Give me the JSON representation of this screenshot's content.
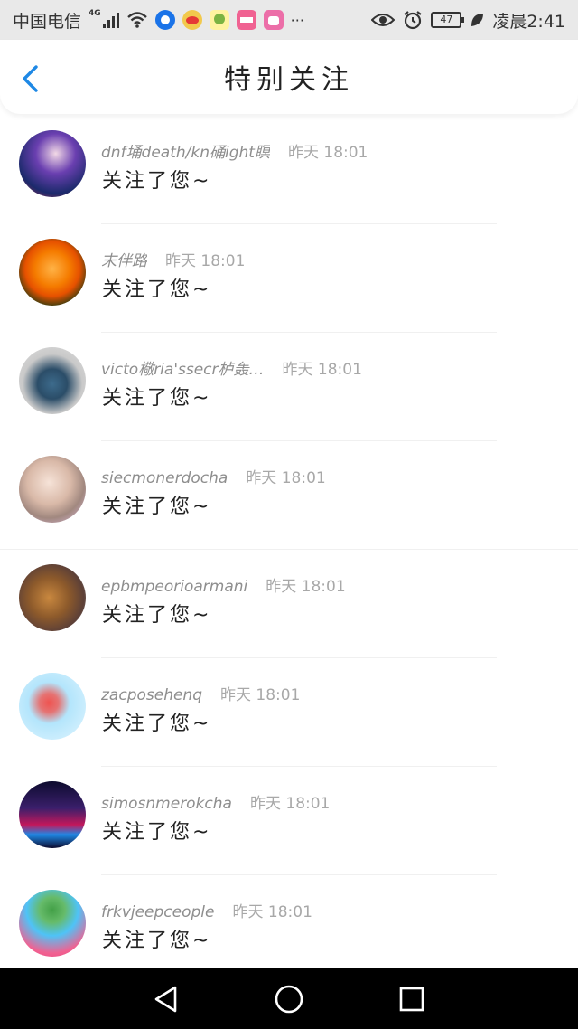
{
  "status_bar": {
    "carrier": "中国电信",
    "network": "4G",
    "battery": "47",
    "time": "凌晨2:41",
    "more": "···"
  },
  "header": {
    "title": "特别关注",
    "back_icon": "chevron-left-icon",
    "accent": "#1e88e5"
  },
  "list": [
    {
      "name": "dnf埇death/kn硧ight瞑",
      "time": "昨天 18:01",
      "message": "关注了您~"
    },
    {
      "name": "末伴路",
      "time": "昨天 18:01",
      "message": "关注了您~"
    },
    {
      "name": "victo㯳ria'ssecr栌轰…",
      "time": "昨天 18:01",
      "message": "关注了您~"
    },
    {
      "name": "siecmonerdocha",
      "time": "昨天 18:01",
      "message": "关注了您~"
    },
    {
      "name": "epbmpeorioarmani",
      "time": "昨天 18:01",
      "message": "关注了您~"
    },
    {
      "name": "zacposehenq",
      "time": "昨天 18:01",
      "message": "关注了您~"
    },
    {
      "name": "simosnmerokcha",
      "time": "昨天 18:01",
      "message": "关注了您~"
    },
    {
      "name": "frkvjeepceople",
      "time": "昨天 18:01",
      "message": "关注了您~"
    }
  ],
  "nav": {
    "back_icon": "triangle-back-icon",
    "home_icon": "circle-home-icon",
    "recents_icon": "square-recents-icon"
  }
}
